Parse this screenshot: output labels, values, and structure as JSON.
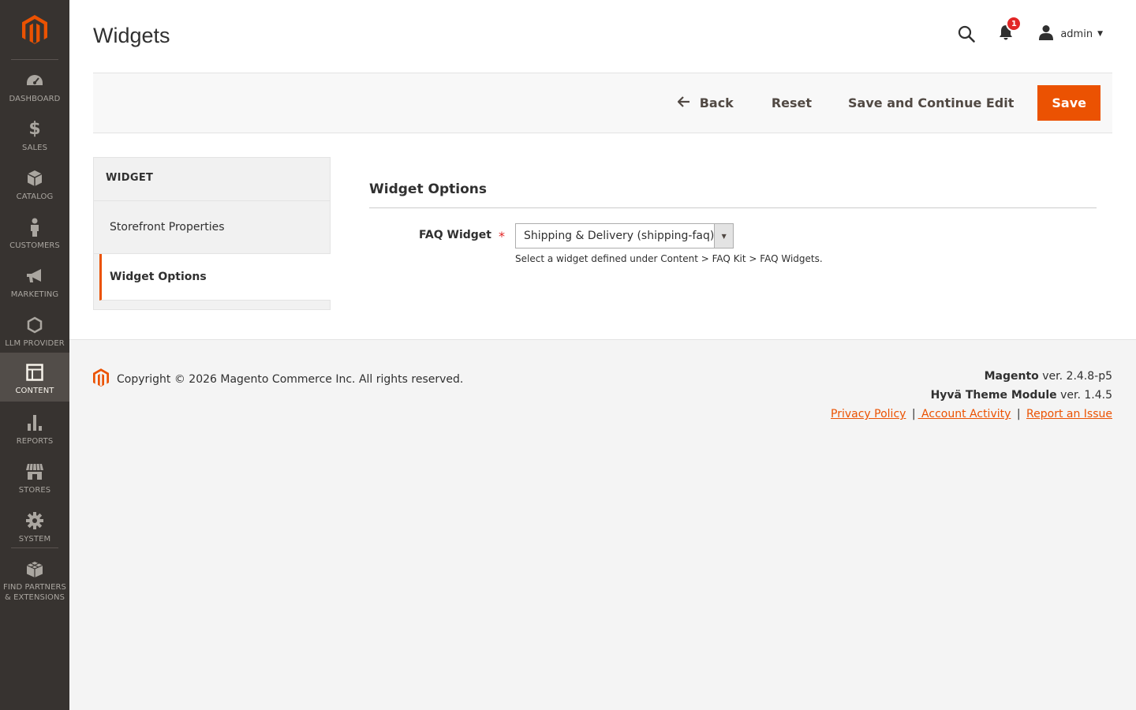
{
  "sidebar": {
    "logo": "magento-logo",
    "items": [
      {
        "label": "DASHBOARD",
        "icon": "dashboard-icon"
      },
      {
        "label": "SALES",
        "icon": "dollar-icon"
      },
      {
        "label": "CATALOG",
        "icon": "box-icon"
      },
      {
        "label": "CUSTOMERS",
        "icon": "person-icon"
      },
      {
        "label": "MARKETING",
        "icon": "megaphone-icon"
      },
      {
        "label": "LLM PROVIDER",
        "icon": "hexagon-icon"
      },
      {
        "label": "CONTENT",
        "icon": "layout-icon",
        "active": true
      },
      {
        "label": "REPORTS",
        "icon": "bar-chart-icon"
      },
      {
        "label": "STORES",
        "icon": "storefront-icon"
      },
      {
        "label": "SYSTEM",
        "icon": "gear-icon"
      },
      {
        "label_line1": "FIND PARTNERS",
        "label_line2": "& EXTENSIONS",
        "icon": "cubes-icon"
      }
    ]
  },
  "header": {
    "title": "Widgets",
    "notification_count": "1",
    "user_name": "admin"
  },
  "actions": {
    "back": "Back",
    "reset": "Reset",
    "save_continue": "Save and Continue Edit",
    "save": "Save"
  },
  "tabs": {
    "title": "WIDGET",
    "items": [
      "Storefront Properties",
      "Widget Options"
    ],
    "active": "Widget Options"
  },
  "form": {
    "fieldset_title": "Widget Options",
    "faq_label": "FAQ Widget",
    "required_mark": "*",
    "faq_value": "Shipping & Delivery (shipping-faq)",
    "faq_note": "Select a widget defined under Content > FAQ Kit > FAQ Widgets."
  },
  "footer": {
    "copyright": "Copyright © 2026 Magento Commerce Inc. All rights reserved.",
    "magento_name": "Magento",
    "magento_ver": " ver. 2.4.8-p5",
    "hyva_name": "Hyvä Theme Module",
    "hyva_ver": " ver. 1.4.5",
    "privacy": "Privacy Policy",
    "activity": " Account Activity",
    "report": "Report an Issue",
    "sep": "|"
  },
  "colors": {
    "accent": "#eb5202",
    "sidebar_bg": "#373330",
    "sidebar_active": "#524d49",
    "badge": "#e22626"
  }
}
